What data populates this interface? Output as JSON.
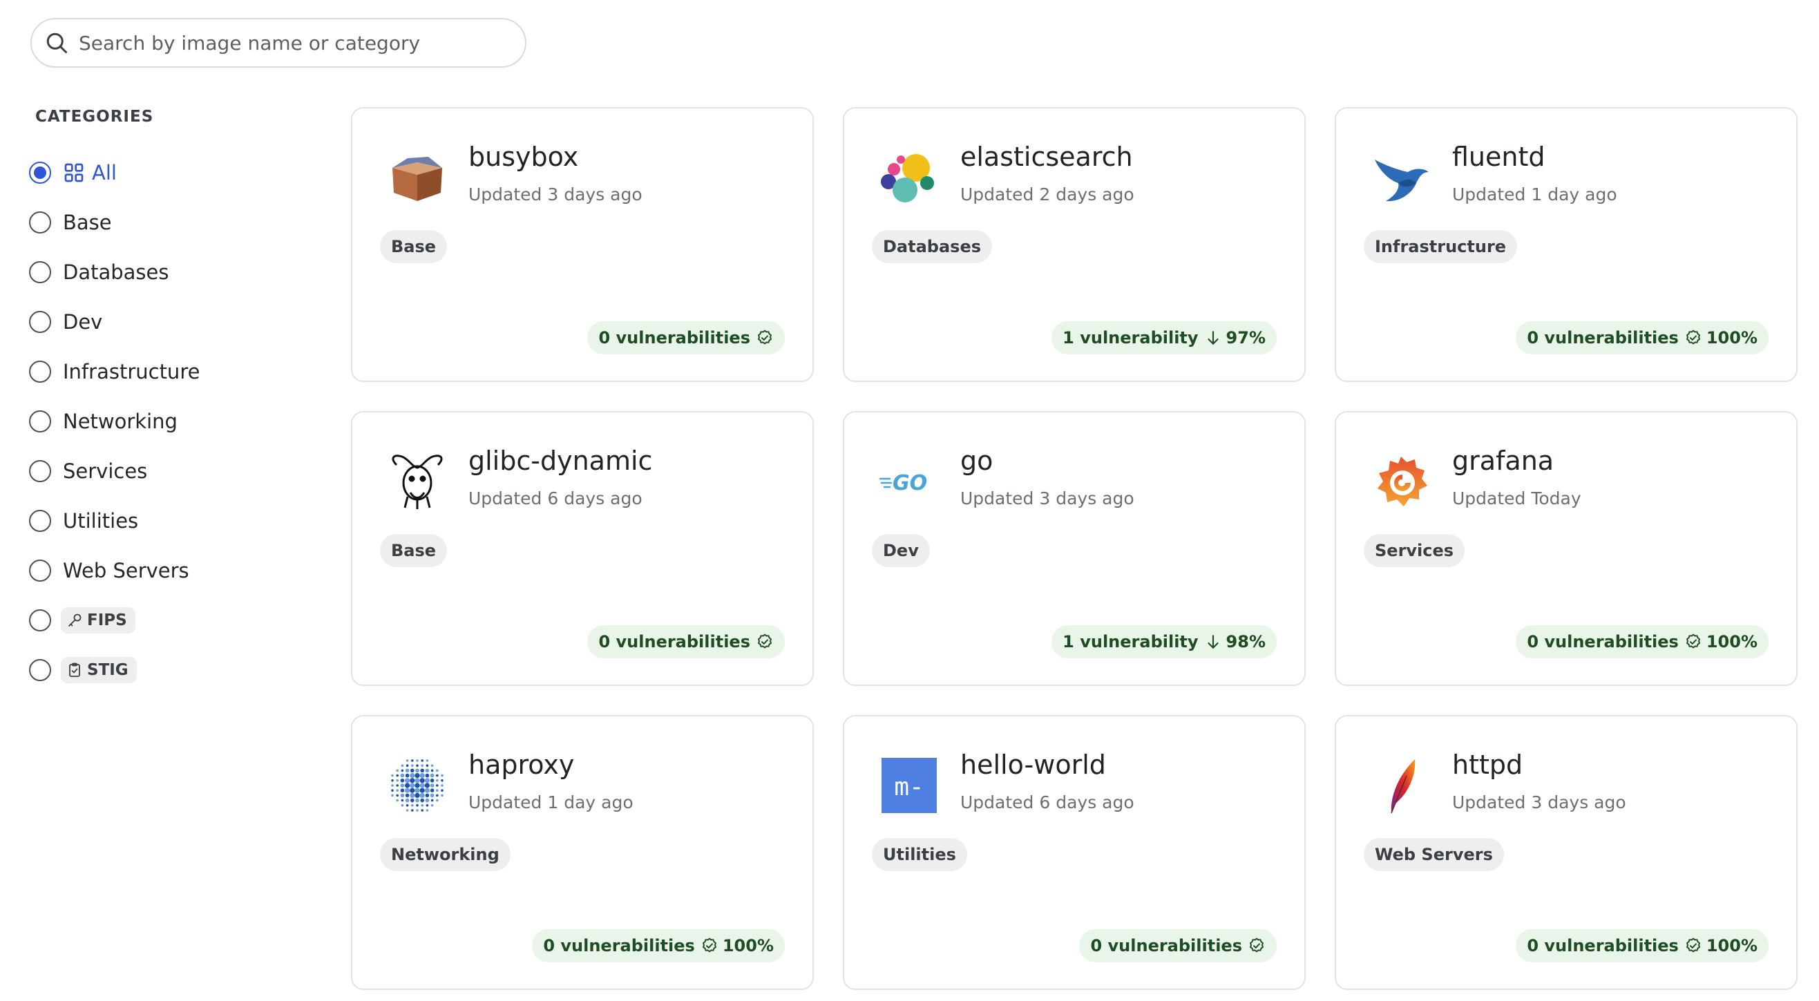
{
  "search": {
    "placeholder": "Search by image name or category"
  },
  "sidebar": {
    "title": "CATEGORIES",
    "items": [
      {
        "label": "All",
        "selected": true,
        "icon": "grid-icon"
      },
      {
        "label": "Base"
      },
      {
        "label": "Databases"
      },
      {
        "label": "Dev"
      },
      {
        "label": "Infrastructure"
      },
      {
        "label": "Networking"
      },
      {
        "label": "Services"
      },
      {
        "label": "Utilities"
      },
      {
        "label": "Web Servers"
      },
      {
        "label": "FIPS",
        "chip": true,
        "icon": "key-icon"
      },
      {
        "label": "STIG",
        "chip": true,
        "icon": "clipboard-check-icon"
      }
    ]
  },
  "colors": {
    "accent": "#2f55d4",
    "vuln_bg": "#e9f5e9",
    "vuln_text": "#1e4d23"
  },
  "cards": [
    {
      "name": "busybox",
      "updated": "Updated 3 days ago",
      "tag": "Base",
      "vuln": "0 vulnerabilities",
      "trend": "check",
      "pct": "",
      "logo": "box-logo"
    },
    {
      "name": "elasticsearch",
      "updated": "Updated 2 days ago",
      "tag": "Databases",
      "vuln": "1 vulnerability",
      "trend": "down",
      "pct": "97%",
      "logo": "elastic-logo"
    },
    {
      "name": "fluentd",
      "updated": "Updated 1 day ago",
      "tag": "Infrastructure",
      "vuln": "0 vulnerabilities",
      "trend": "check",
      "pct": "100%",
      "logo": "bird-logo"
    },
    {
      "name": "glibc-dynamic",
      "updated": "Updated 6 days ago",
      "tag": "Base",
      "vuln": "0 vulnerabilities",
      "trend": "check",
      "pct": "",
      "logo": "gnu-logo"
    },
    {
      "name": "go",
      "updated": "Updated 3 days ago",
      "tag": "Dev",
      "vuln": "1 vulnerability",
      "trend": "down",
      "pct": "98%",
      "logo": "go-logo",
      "logo_text": "GO"
    },
    {
      "name": "grafana",
      "updated": "Updated Today",
      "tag": "Services",
      "vuln": "0 vulnerabilities",
      "trend": "check",
      "pct": "100%",
      "logo": "grafana-logo"
    },
    {
      "name": "haproxy",
      "updated": "Updated 1 day ago",
      "tag": "Networking",
      "vuln": "0 vulnerabilities",
      "trend": "check",
      "pct": "100%",
      "logo": "haproxy-logo"
    },
    {
      "name": "hello-world",
      "updated": "Updated 6 days ago",
      "tag": "Utilities",
      "vuln": "0 vulnerabilities",
      "trend": "check",
      "pct": "",
      "logo": "hello-world-logo",
      "logo_text": "m-"
    },
    {
      "name": "httpd",
      "updated": "Updated 3 days ago",
      "tag": "Web Servers",
      "vuln": "0 vulnerabilities",
      "trend": "check",
      "pct": "100%",
      "logo": "feather-logo"
    }
  ]
}
